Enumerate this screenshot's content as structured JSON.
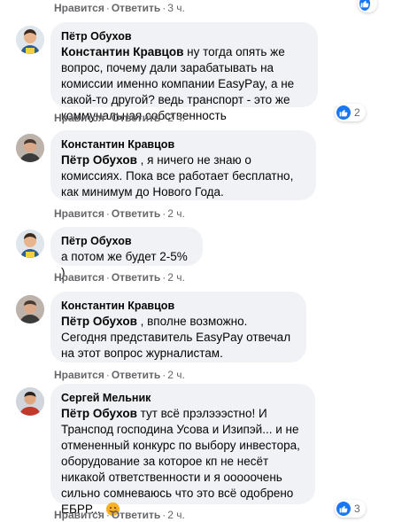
{
  "ui": {
    "like_label": "Нравится",
    "reply_label": "Ответить",
    "dot": "·"
  },
  "top_row": {
    "time": "3 ч."
  },
  "comments": [
    {
      "author": "Пётр Обухов",
      "mention": "Константин Кравцов",
      "text": " ну тогда опять же вопрос, почему дали зарабатывать на комиссии именно компании EasyPay, а не какой-то другой? ведь транспорт - это же коммунальная собственность",
      "time": "2 ч.",
      "reactions": "2"
    },
    {
      "author": "Константин Кравцов",
      "mention": "Пётр Обухов",
      "text": " , я ничего не знаю о комиссиях. Пока все работает бесплатно, как минимум до Нового Года.",
      "time": "2 ч."
    },
    {
      "author": "Пётр Обухов",
      "text": "а потом же будет 2-5% )",
      "time": "2 ч."
    },
    {
      "author": "Константин Кравцов",
      "mention": "Пётр Обухов",
      "text": " , вполне возможно. Сегодня представитель EasyPay отвечал на этот вопрос журналистам.",
      "time": "2 ч."
    },
    {
      "author": "Сергей Мельник",
      "mention": "Пётр Обухов",
      "text": " тут всё прэлэээстно! И Транспод господина Усова и Изипэй... и не отмененный конкурс по выбору инвестора, оборудование за которое кп не несёт никакой ответственности и я ооооочень сильно сомневаюсь что это всё одобрено ЕБРР... ",
      "time": "2 ч.",
      "reactions": "3"
    }
  ],
  "colors": {
    "bubble": "#f0f2f5",
    "meta": "#65676b",
    "like": "#1877f2"
  }
}
